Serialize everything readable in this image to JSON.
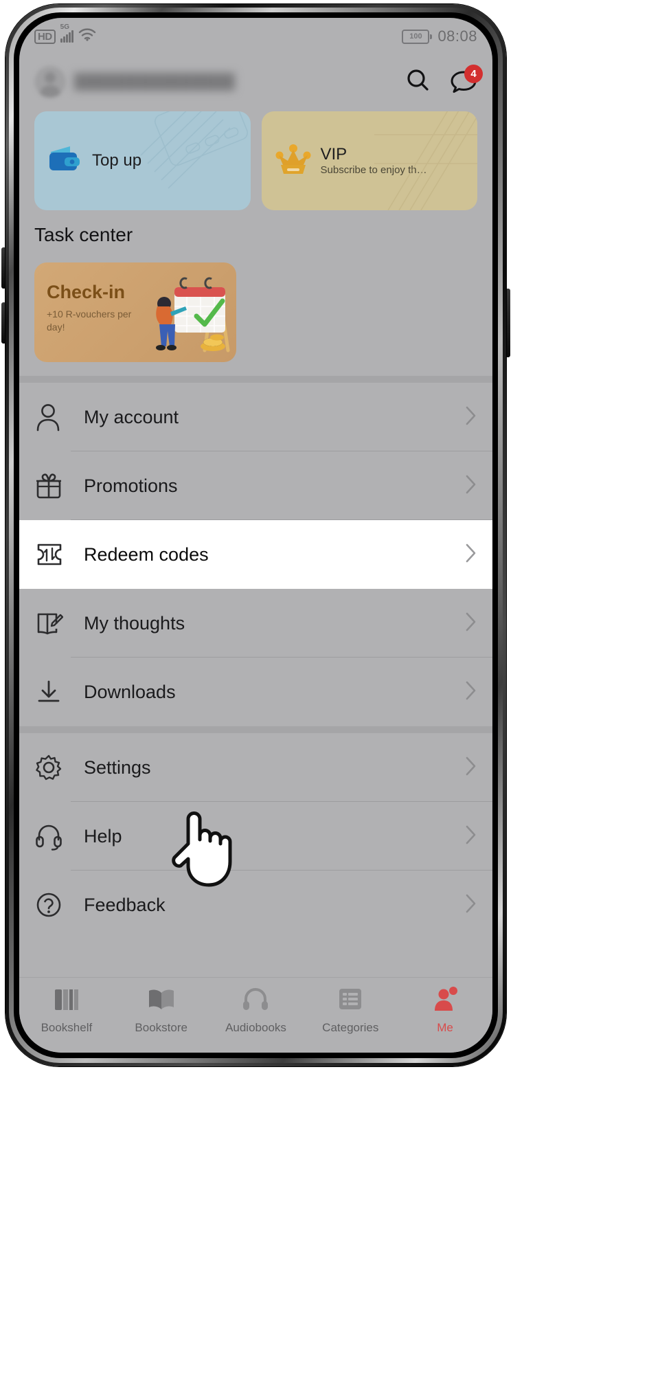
{
  "status_bar": {
    "hd_label": "HD",
    "network_label": "5G",
    "wifi_icon": "wifi-icon",
    "signal_icon": "signal-bars-icon",
    "battery_level": "100",
    "time": "08:08"
  },
  "header": {
    "avatar_icon": "avatar",
    "username": "███████████████",
    "search_icon": "search-icon",
    "messages_icon": "message-bubble-icon",
    "messages_badge": "4"
  },
  "cards": [
    {
      "id": "top-up",
      "title": "Top up",
      "subtitle": "",
      "icon": "wallet-icon",
      "color": "#a9c7d4"
    },
    {
      "id": "vip",
      "title": "VIP",
      "subtitle": "Subscribe to enjoy th…",
      "icon": "crown-icon",
      "color": "#cfc295"
    }
  ],
  "task_center": {
    "section_title": "Task center",
    "checkin": {
      "title": "Check-in",
      "subtitle": "+10 R-vouchers per day!",
      "illustration": "calendar-checkmark-illustration"
    }
  },
  "menu": {
    "group_one": [
      {
        "label": "My account",
        "icon": "person-icon",
        "chevron": "chevron-right-icon",
        "active": false
      },
      {
        "label": "Promotions",
        "icon": "gift-icon",
        "chevron": "chevron-right-icon",
        "active": false
      },
      {
        "label": "Redeem codes",
        "icon": "ticket-icon",
        "chevron": "chevron-right-icon",
        "active": true
      },
      {
        "label": "My thoughts",
        "icon": "book-edit-icon",
        "chevron": "chevron-right-icon",
        "active": false
      },
      {
        "label": "Downloads",
        "icon": "download-icon",
        "chevron": "chevron-right-icon",
        "active": false
      }
    ],
    "group_two": [
      {
        "label": "Settings",
        "icon": "gear-icon",
        "chevron": "chevron-right-icon",
        "active": false
      },
      {
        "label": "Help",
        "icon": "headset-icon",
        "chevron": "chevron-right-icon",
        "active": false
      },
      {
        "label": "Feedback",
        "icon": "feedback-icon",
        "chevron": "chevron-right-icon",
        "active": false
      }
    ]
  },
  "tab_bar": {
    "items": [
      {
        "label": "Bookshelf",
        "icon": "bookshelf-icon",
        "selected": false
      },
      {
        "label": "Bookstore",
        "icon": "open-book-icon",
        "selected": false
      },
      {
        "label": "Audiobooks",
        "icon": "headphones-icon",
        "selected": false
      },
      {
        "label": "Categories",
        "icon": "list-icon",
        "selected": false
      },
      {
        "label": "Me",
        "icon": "person-badge-icon",
        "selected": true
      }
    ],
    "accent_color": "#d84b4b"
  },
  "cursor": {
    "icon": "pointing-hand-cursor"
  }
}
